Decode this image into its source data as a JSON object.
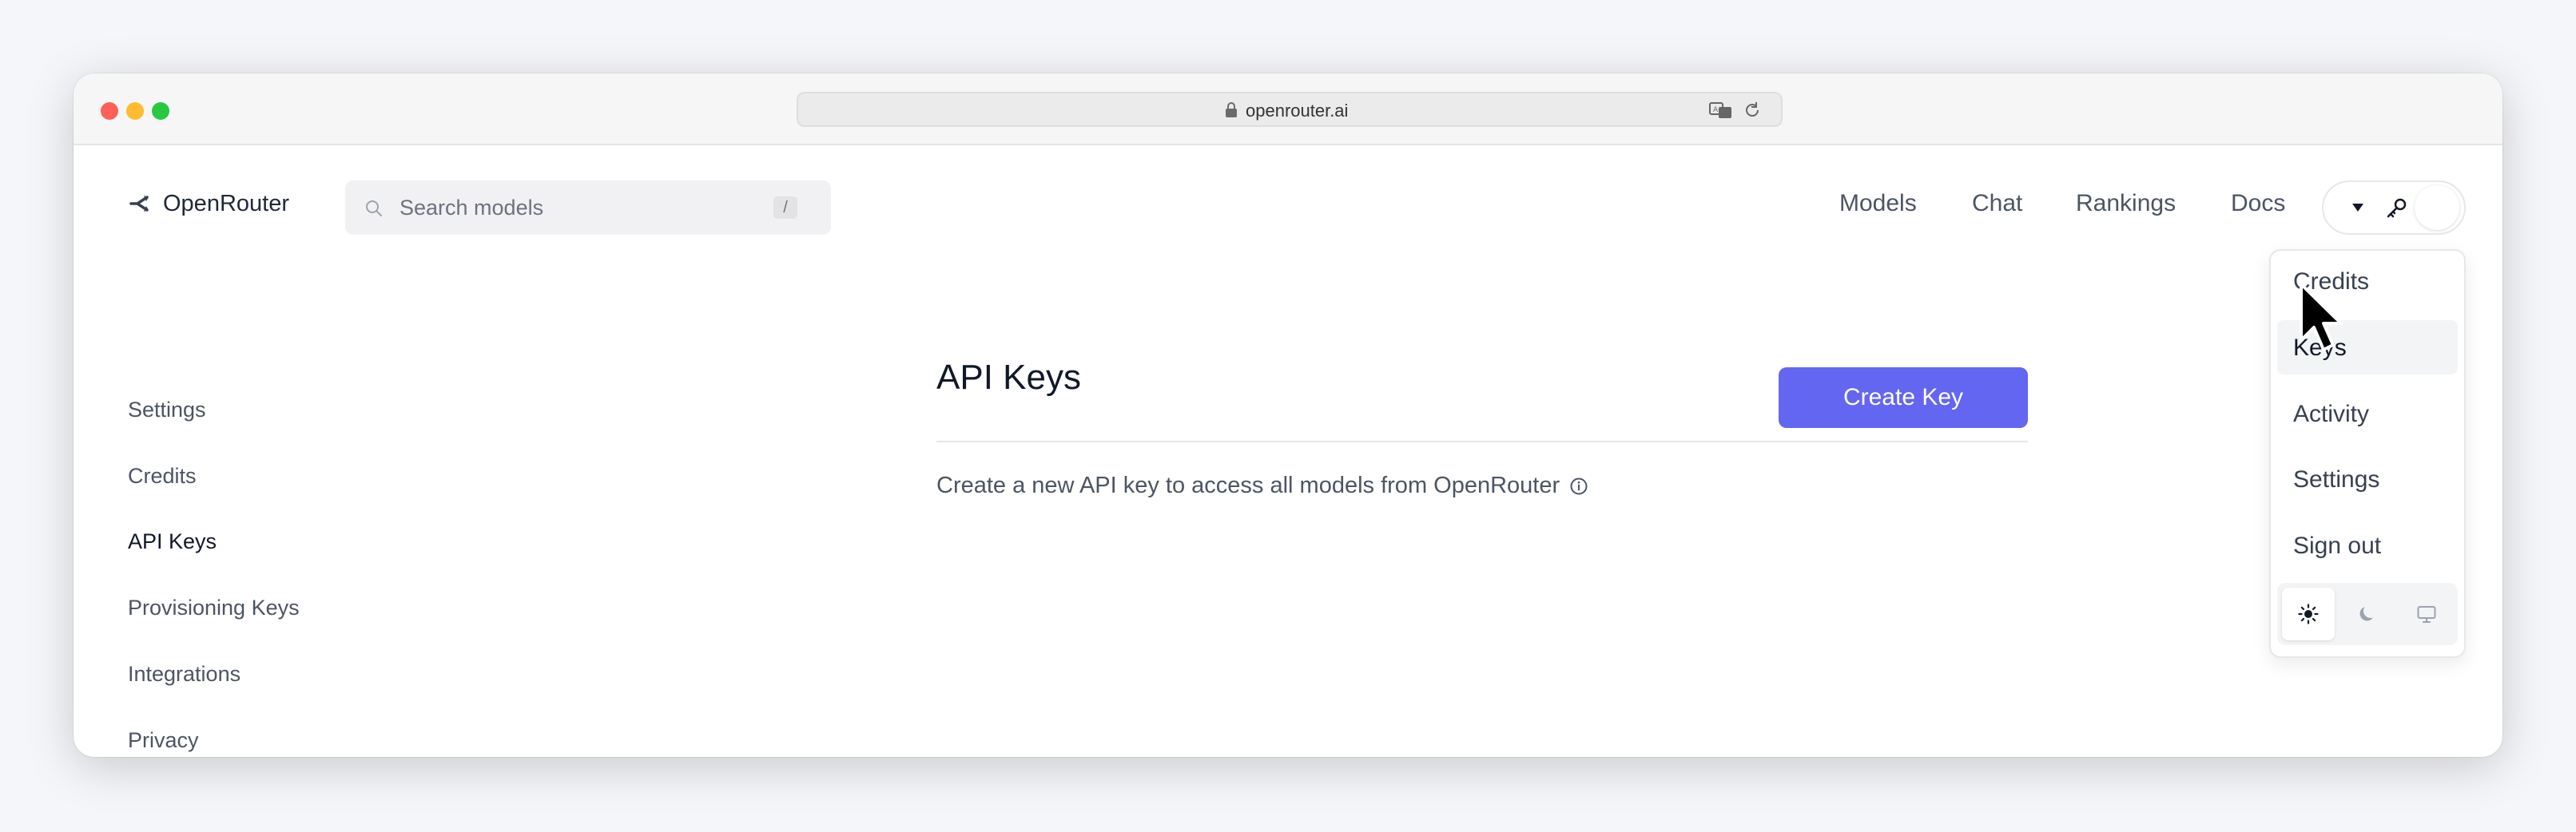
{
  "browser": {
    "url": "openrouter.ai"
  },
  "header": {
    "logo_text": "OpenRouter",
    "search_placeholder": "Search models",
    "search_shortcut": "/",
    "nav": {
      "models": "Models",
      "chat": "Chat",
      "rankings": "Rankings",
      "docs": "Docs"
    }
  },
  "sidebar": {
    "items": [
      {
        "label": "Settings"
      },
      {
        "label": "Credits"
      },
      {
        "label": "API Keys",
        "active": true
      },
      {
        "label": "Provisioning Keys"
      },
      {
        "label": "Integrations"
      },
      {
        "label": "Privacy"
      }
    ]
  },
  "main": {
    "title": "API Keys",
    "create_button": "Create Key",
    "description": "Create a new API key to access all models from OpenRouter"
  },
  "dropdown": {
    "items": [
      {
        "label": "Credits"
      },
      {
        "label": "Keys",
        "active": true
      },
      {
        "label": "Activity"
      },
      {
        "label": "Settings"
      },
      {
        "label": "Sign out"
      }
    ],
    "theme_options": [
      "sun-icon",
      "moon-icon",
      "monitor-icon"
    ],
    "theme_selected": "sun-icon"
  },
  "colors": {
    "accent": "#6366f1",
    "text_primary": "#111827",
    "text_secondary": "#4b5563"
  }
}
